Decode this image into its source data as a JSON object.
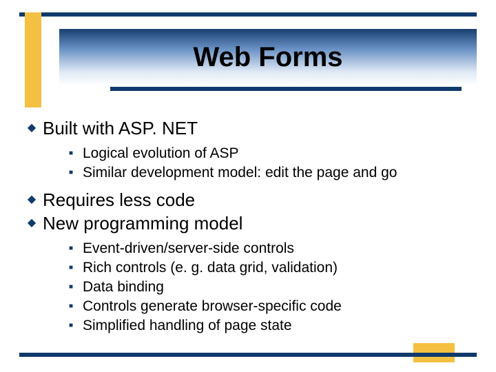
{
  "title": "Web Forms",
  "bullets": [
    {
      "text": "Built with ASP. NET",
      "sub": [
        "Logical evolution of ASP",
        "Similar development model: edit the page and go"
      ]
    },
    {
      "text": "Requires less code",
      "sub": []
    },
    {
      "text": "New programming model",
      "sub": [
        "Event-driven/server-side controls",
        "Rich controls (e. g. data grid, validation)",
        "Data binding",
        "Controls generate browser-specific code",
        "Simplified handling of page state"
      ]
    }
  ]
}
